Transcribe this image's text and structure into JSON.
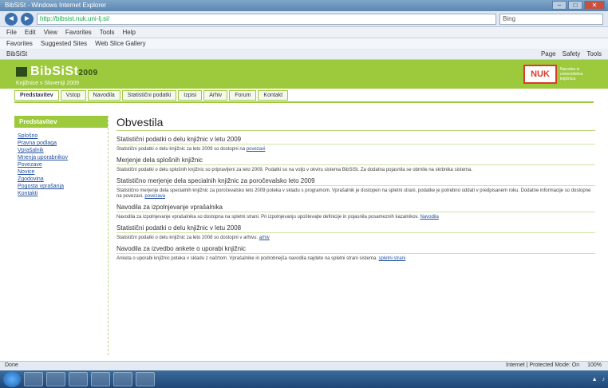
{
  "browser": {
    "title": "BibSiSt - Windows Internet Explorer",
    "url": "http://bibsist.nuk.uni-lj.si/",
    "search_placeholder": "Bing",
    "menu": [
      "File",
      "Edit",
      "View",
      "Favorites",
      "Tools",
      "Help"
    ],
    "favorites": [
      "Favorites",
      "Suggested Sites",
      "Web Slice Gallery"
    ],
    "tab_title": "BibSiSt",
    "cmd_right": [
      "Page",
      "Safety",
      "Tools"
    ],
    "status_left": "Done",
    "status_right": [
      "Internet | Protected Mode: On",
      "100%"
    ]
  },
  "site": {
    "logo": "BibSiSt",
    "logo_sup": "2009",
    "subtitle": "Knjižnice v Sloveniji 2009",
    "nuk_mark": "NUK",
    "nuk_text": "Narodna in univerzitetna knjižnica"
  },
  "tabs": [
    {
      "label": "Predstavitev",
      "active": true
    },
    {
      "label": "Vstop"
    },
    {
      "label": "Navodila"
    },
    {
      "label": "Statistični podatki"
    },
    {
      "label": "Izpisi"
    },
    {
      "label": "Arhiv"
    },
    {
      "label": "Forum"
    },
    {
      "label": "Kontakt"
    }
  ],
  "sidebar": {
    "heading": "Predstavitev",
    "items": [
      "Splošno",
      "Pravna podlaga",
      "Vprašalnik",
      "Mnenja uporabnikov",
      "Povezave",
      "Novice",
      "Zgodovina",
      "Pogosta vprašanja",
      "Kontakti"
    ]
  },
  "main": {
    "title": "Obvestila",
    "sections": [
      {
        "heading": "Statistični podatki o delu knjižnic v letu 2009",
        "text": "Statistični podatki o delu knjižnic za leto 2009 so dostopni na",
        "link": "povezavi"
      },
      {
        "heading": "Merjenje dela splošnih knjižnic",
        "text": "Statistični podatki o delu splošnih knjižnic so pripravljeni za leto 2009. Podatki so na voljo v okviru sistema BibSiSt. Za dodatna pojasnila se obrnite na skrbnika sistema.",
        "link": ""
      },
      {
        "heading": "Statistično merjenje dela specialnih knjižnic za poročevalsko leto 2009",
        "text": "Statistično merjenje dela specialnih knjižnic za poročevalsko leto 2009 poteka v skladu s programom. Vprašalnik je dostopen na spletni strani, podatke je potrebno oddati v predpisanem roku. Dodatne informacije so dostopne na povezavi.",
        "link": "povezava"
      },
      {
        "heading": "Navodila za izpolnjevanje vprašalnika",
        "text": "Navodila za izpolnjevanje vprašalnika so dostopna na spletni strani. Pri izpolnjevanju upoštevajte definicije in pojasnila posameznih kazalnikov.",
        "link": "Navodila"
      },
      {
        "heading": "Statistični podatki o delu knjižnic v letu 2008",
        "text": "Statistični podatki o delu knjižnic za leto 2008 so dostopni v arhivu.",
        "link": "arhiv"
      },
      {
        "heading": "Navodila za izvedbo ankete o uporabi knjižnic",
        "text": "Anketa o uporabi knjižnic poteka v skladu z načrtom. Vprašalnike in podrobnejša navodila najdete na spletni strani sistema.",
        "link": "spletni strani"
      }
    ]
  }
}
